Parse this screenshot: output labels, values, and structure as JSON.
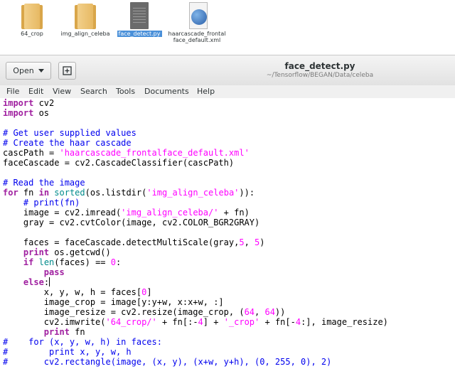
{
  "desktop": {
    "files": [
      {
        "name": "64_crop",
        "icon": "folder-icon",
        "selected": false
      },
      {
        "name": "img_align_celeba",
        "icon": "folder-icon",
        "selected": false
      },
      {
        "name": "face_detect.py",
        "icon": "python-file-icon",
        "selected": true
      },
      {
        "name": "haarcascade_frontalface_default.xml",
        "icon": "xml-file-icon",
        "selected": false
      }
    ]
  },
  "header": {
    "open_label": "Open",
    "title": "face_detect.py",
    "subtitle": "~/Tensorflow/BEGAN/Data/celeba"
  },
  "menu": [
    "File",
    "Edit",
    "View",
    "Search",
    "Tools",
    "Documents",
    "Help"
  ],
  "code": {
    "lines": [
      "import cv2",
      "import os",
      "",
      "# Get user supplied values",
      "# Create the haar cascade",
      "cascPath = 'haarcascade_frontalface_default.xml'",
      "faceCascade = cv2.CascadeClassifier(cascPath)",
      "",
      "# Read the image",
      "for fn in sorted(os.listdir('img_align_celeba')):",
      "    # print(fn)",
      "    image = cv2.imread('img_align_celeba/' + fn)",
      "    gray = cv2.cvtColor(image, cv2.COLOR_BGR2GRAY)",
      "",
      "    faces = faceCascade.detectMultiScale(gray,5, 5)",
      "    print os.getcwd()",
      "    if len(faces) == 0:",
      "        pass",
      "    else:",
      "        x, y, w, h = faces[0]",
      "        image_crop = image[y:y+w, x:x+w, :]",
      "        image_resize = cv2.resize(image_crop, (64, 64))",
      "        cv2.imwrite('64_crop/' + fn[:-4] + '_crop' + fn[-4:], image_resize)",
      "        print fn",
      "#    for (x, y, w, h) in faces:",
      "#        print x, y, w, h",
      "#       cv2.rectangle(image, (x, y), (x+w, y+h), (0, 255, 0), 2)"
    ]
  },
  "colors": {
    "keyword": "#a020a0",
    "builtin": "#008b8b",
    "string": "#ff00ff",
    "comment": "#0000ee",
    "selection": "#4a90d9"
  }
}
